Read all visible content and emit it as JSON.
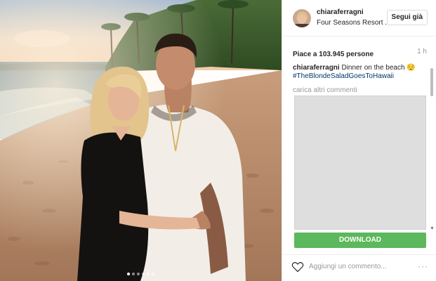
{
  "post": {
    "username": "chiaraferragni",
    "location": "Four Seasons Resort ...",
    "follow_label": "Segui già",
    "likes": "Piace a 103.945 persone",
    "time": "1 h",
    "caption_user": "chiaraferragni",
    "caption_text": " Dinner on the beach 😌",
    "hashtag": "#TheBlondeSaladGoesToHawaii",
    "load_more": "carica altri commenti",
    "comment_placeholder": "Aggiungi un commento...",
    "more_options": "···"
  },
  "ad": {
    "download_label": "DOWNLOAD"
  },
  "carousel": {
    "total": 6,
    "active": 1
  },
  "colors": {
    "download": "#5cb85c",
    "hashtag": "#003569"
  }
}
